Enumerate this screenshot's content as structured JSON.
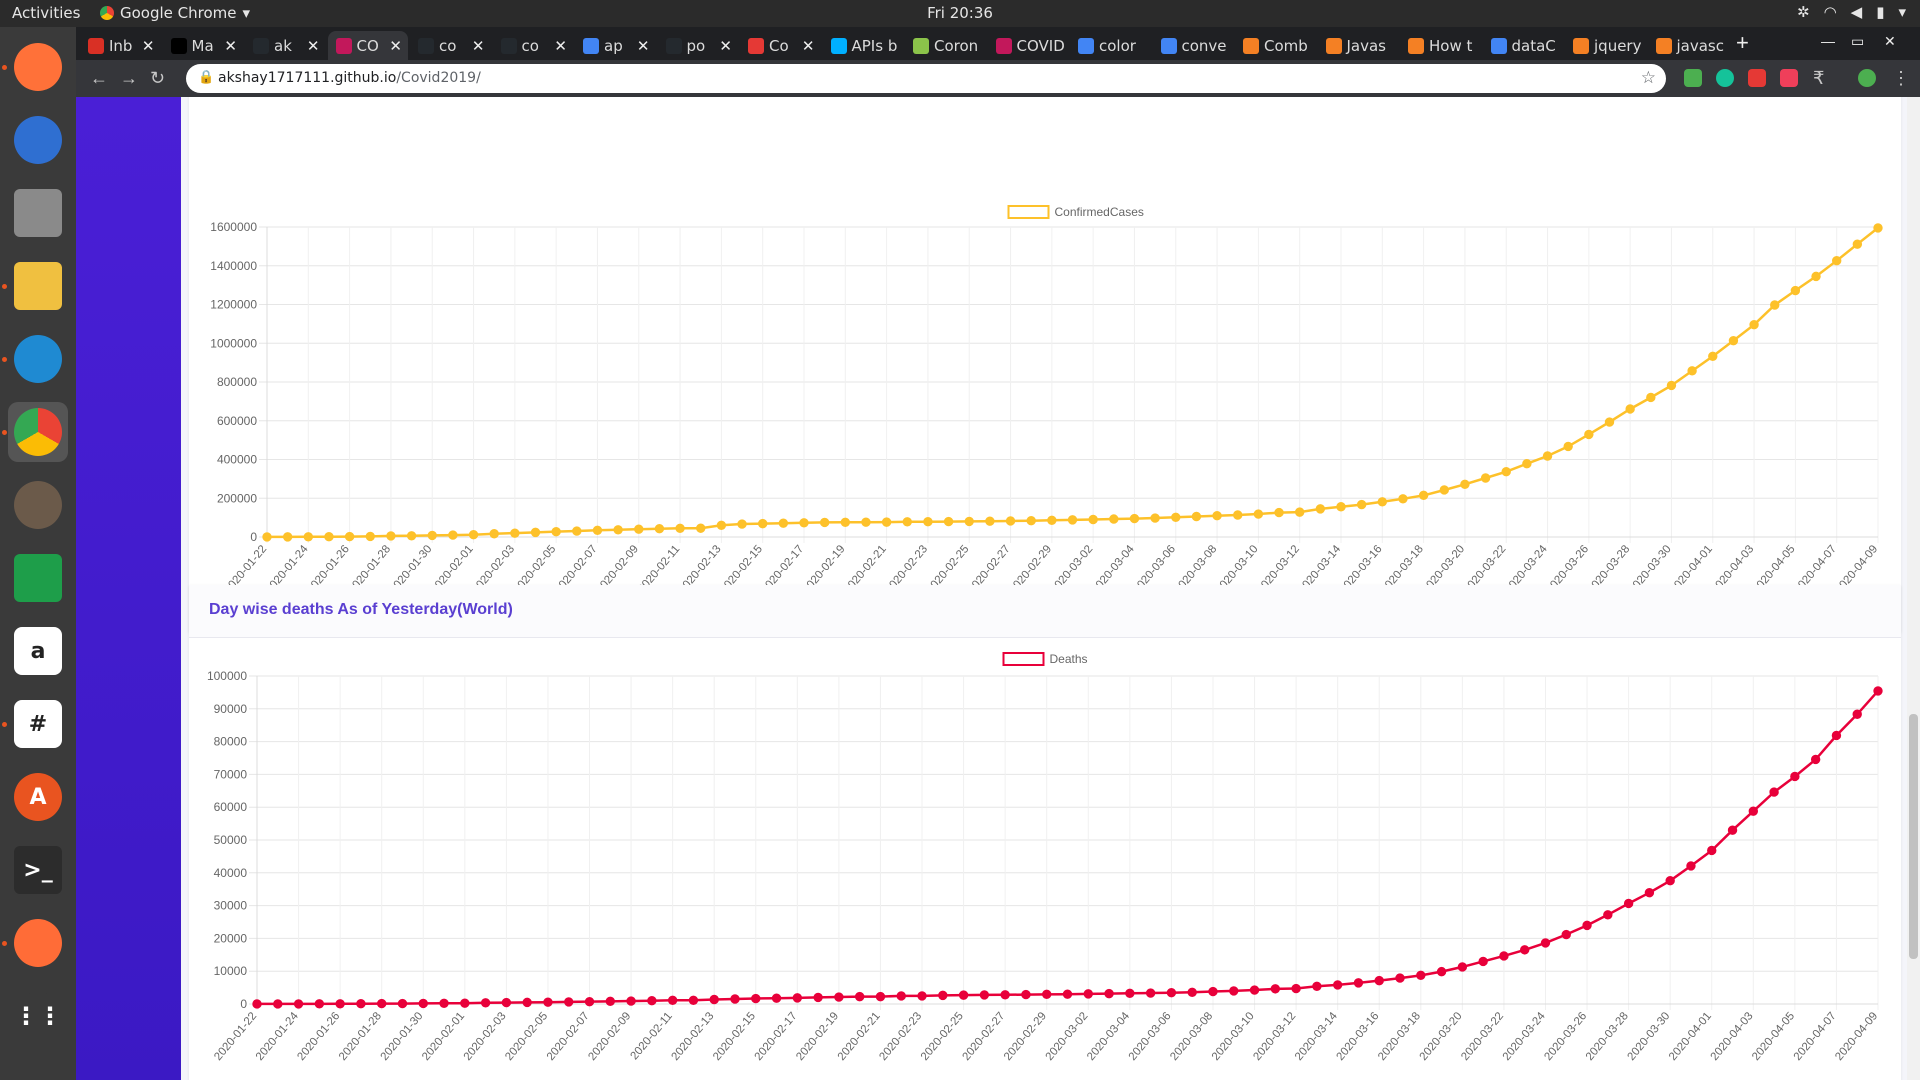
{
  "system": {
    "activities": "Activities",
    "app_name": "Google Chrome",
    "clock": "Fri 20:36"
  },
  "browser": {
    "tabs": [
      {
        "label": "Inb",
        "color": "#d93025"
      },
      {
        "label": "Ma",
        "color": "#000000"
      },
      {
        "label": "ak",
        "color": "#24292e"
      },
      {
        "label": "CO",
        "color": "#c2185b",
        "active": true
      },
      {
        "label": "co",
        "color": "#24292e"
      },
      {
        "label": "co",
        "color": "#24292e"
      },
      {
        "label": "ap",
        "color": "#4285f4"
      },
      {
        "label": "po",
        "color": "#24292e"
      },
      {
        "label": "Co",
        "color": "#e53935"
      },
      {
        "label": "APIs b",
        "color": "#00b0ff"
      },
      {
        "label": "Coron",
        "color": "#8bc34a"
      },
      {
        "label": "COVID",
        "color": "#c2185b"
      },
      {
        "label": "color",
        "color": "#4285f4"
      },
      {
        "label": "conve",
        "color": "#4285f4"
      },
      {
        "label": "Comb",
        "color": "#f48024"
      },
      {
        "label": "Javas",
        "color": "#f48024"
      },
      {
        "label": "How t",
        "color": "#f48024"
      },
      {
        "label": "dataC",
        "color": "#4285f4"
      },
      {
        "label": "jquery",
        "color": "#f48024"
      },
      {
        "label": "javasc",
        "color": "#f48024"
      }
    ],
    "new_tab": "+",
    "url_host": "akshay1717111.github.io",
    "url_path": "/Covid2019/"
  },
  "dock": [
    {
      "name": "firefox",
      "color": "#ff7139",
      "running": true
    },
    {
      "name": "thunderbird",
      "color": "#2f6fd1",
      "running": false
    },
    {
      "name": "files",
      "color": "#8a8a8a",
      "running": false
    },
    {
      "name": "text-editor",
      "color": "#f0c040",
      "running": true
    },
    {
      "name": "vscode",
      "color": "#1f8ad2",
      "running": true
    },
    {
      "name": "chrome",
      "color": "#4285f4",
      "running": true
    },
    {
      "name": "gimp",
      "color": "#6b5a4a",
      "running": false
    },
    {
      "name": "spreadsheet",
      "color": "#1e9e4a",
      "running": false
    },
    {
      "name": "amazon",
      "color": "#ffffff",
      "running": false
    },
    {
      "name": "slack",
      "color": "#ffffff",
      "running": true
    },
    {
      "name": "software",
      "color": "#e95420",
      "running": false
    },
    {
      "name": "terminal",
      "color": "#2c2c2c",
      "running": false
    },
    {
      "name": "postman",
      "color": "#ff6c37",
      "running": true
    },
    {
      "name": "app-grid",
      "color": "#3a3a3a",
      "running": false
    }
  ],
  "cards": {
    "deaths_title": "Day wise deaths As of Yesterday(World)"
  },
  "chart_data": [
    {
      "type": "line",
      "legend": "ConfirmedCases",
      "color": "#fdc12a",
      "ylim": [
        0,
        1600000
      ],
      "yticks": [
        0,
        200000,
        400000,
        600000,
        800000,
        1000000,
        1200000,
        1400000,
        1600000
      ],
      "x_start": "2020-01-22",
      "x_end": "2020-04-09",
      "values": [
        555,
        654,
        941,
        1434,
        2118,
        2927,
        5578,
        6166,
        8234,
        9927,
        12038,
        16787,
        19881,
        23892,
        27635,
        30794,
        34391,
        37120,
        40150,
        42762,
        44802,
        45221,
        60368,
        66885,
        69030,
        71224,
        73258,
        75136,
        75639,
        76197,
        76819,
        78572,
        78958,
        79561,
        80406,
        81388,
        82746,
        84112,
        86011,
        88369,
        90306,
        92840,
        95120,
        97886,
        101801,
        105847,
        109821,
        113590,
        118620,
        125875,
        128343,
        145193,
        156097,
        167449,
        181546,
        197168,
        214915,
        242713,
        272167,
        304528,
        336953,
        378235,
        418045,
        467653,
        529591,
        593291,
        660706,
        720117,
        782365,
        857487,
        932605,
        1013466,
        1095917,
        1197405,
        1272115,
        1345101,
        1426096,
        1511104,
        1595350
      ]
    },
    {
      "type": "line",
      "legend": "Deaths",
      "color": "#e8003a",
      "ylim": [
        0,
        100000
      ],
      "yticks": [
        0,
        10000,
        20000,
        30000,
        40000,
        50000,
        60000,
        70000,
        80000,
        90000,
        100000
      ],
      "x_start": "2020-01-22",
      "x_end": "2020-04-09",
      "values": [
        17,
        18,
        26,
        42,
        56,
        82,
        131,
        133,
        171,
        213,
        259,
        362,
        426,
        492,
        564,
        634,
        719,
        806,
        906,
        1013,
        1113,
        1118,
        1371,
        1523,
        1666,
        1770,
        1868,
        2007,
        2122,
        2247,
        2251,
        2458,
        2469,
        2629,
        2708,
        2770,
        2814,
        2872,
        2941,
        2996,
        3085,
        3160,
        3254,
        3348,
        3460,
        3558,
        3803,
        3996,
        4262,
        4615,
        4720,
        5404,
        5819,
        6440,
        7126,
        7905,
        8733,
        9867,
        11299,
        12973,
        14651,
        16505,
        18625,
        21181,
        23970,
        27198,
        30652,
        33925,
        37582,
        42107,
        46809,
        52983,
        58787,
        64606,
        69374,
        74565,
        81865,
        88338,
        95455
      ]
    }
  ]
}
